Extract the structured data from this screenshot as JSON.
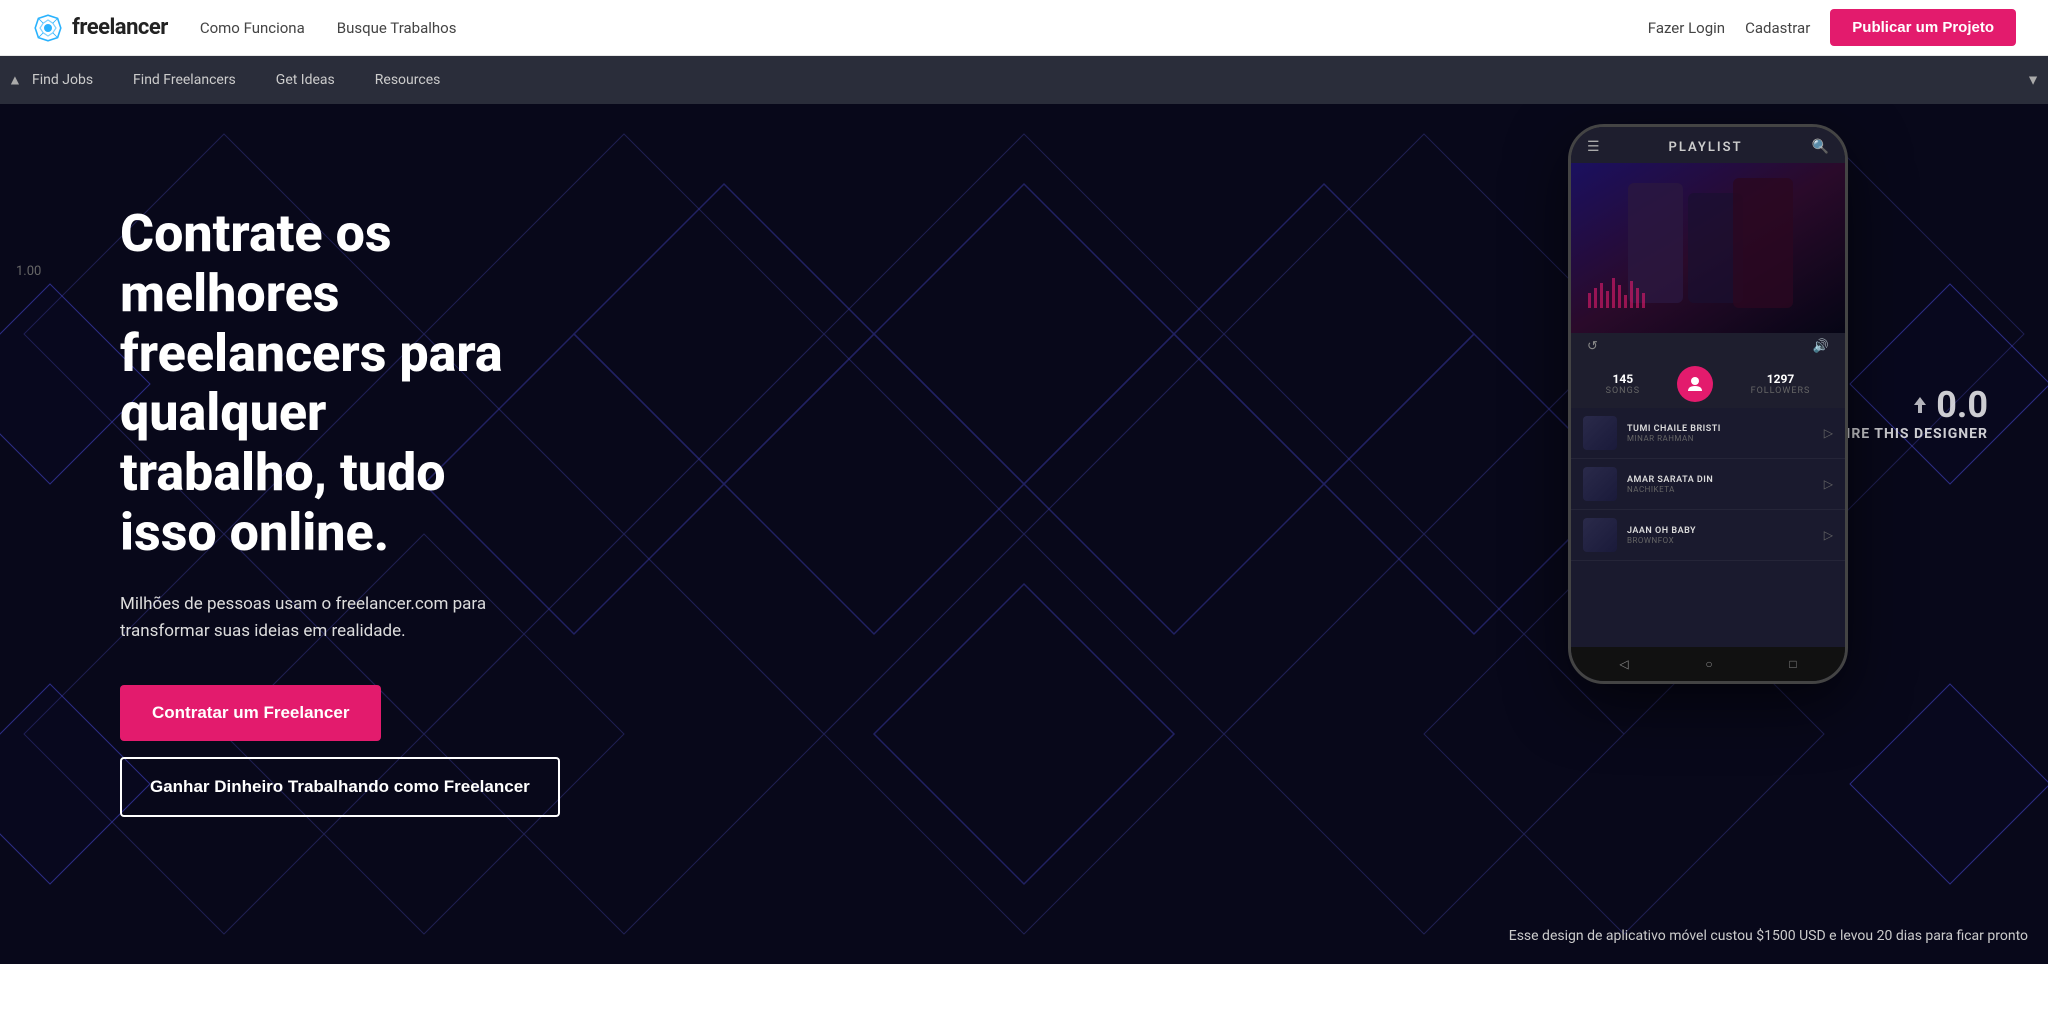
{
  "topNav": {
    "logo_text": "freelancer",
    "nav_links": [
      {
        "id": "como-funciona",
        "label": "Como Funciona"
      },
      {
        "id": "busque-trabalhos",
        "label": "Busque Trabalhos"
      }
    ],
    "right_links": [
      {
        "id": "fazer-login",
        "label": "Fazer Login"
      },
      {
        "id": "cadastrar",
        "label": "Cadastrar"
      }
    ],
    "publish_button": "Publicar um Projeto"
  },
  "secondaryNav": {
    "items": [
      {
        "id": "find-jobs",
        "label": "Find Jobs"
      },
      {
        "id": "find-freelancers",
        "label": "Find Freelancers"
      },
      {
        "id": "get-ideas",
        "label": "Get Ideas"
      },
      {
        "id": "resources",
        "label": "Resources"
      }
    ]
  },
  "hero": {
    "title": "Contrate os melhores freelancers para qualquer trabalho, tudo isso online.",
    "subtitle": "Milhões de pessoas usam o freelancer.com para transformar suas ideias em realidade.",
    "btn_hire": "Contratar um Freelancer",
    "btn_earn": "Ganhar Dinheiro Trabalhando como Freelancer",
    "side_number": "1.00"
  },
  "phoneApp": {
    "top_bar_title": "PLAYLIST",
    "stats": [
      {
        "number": "145",
        "label": "SONGS"
      },
      {
        "number": "1297",
        "label": "FOLLOWERS"
      }
    ],
    "songs": [
      {
        "title": "TUMI CHAILE BRISTI",
        "artist": "MINAR RAHMAN"
      },
      {
        "title": "AMAR SARATA DIN",
        "artist": "NACHIKETA"
      },
      {
        "title": "JAAN OH BABY",
        "artist": "BROWNFOX"
      }
    ]
  },
  "designerCard": {
    "rating": "0.0",
    "label": "HIRE THIS DESIGNER"
  },
  "caption": "Esse design de aplicativo móvel custou $1500 USD e levou 20 dias para ficar pronto",
  "colors": {
    "accent_pink": "#e31b6d",
    "dark_bg": "#0d0d1a",
    "nav_dark": "#2a2d3a"
  }
}
